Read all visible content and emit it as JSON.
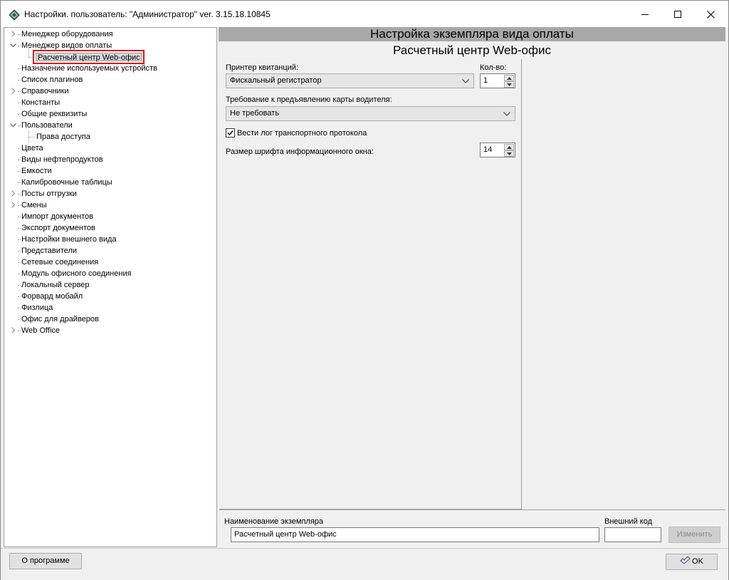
{
  "window": {
    "title": "Настройки. пользователь: \"Администратор\" ver. 3.15.18.10845"
  },
  "tree": {
    "items": [
      {
        "label": "Менеджер оборудования",
        "expander": "collapsed",
        "level": 0
      },
      {
        "label": "Менеджер видов оплаты",
        "expander": "expanded",
        "level": 0
      },
      {
        "label": "Расчетный центр Web-офис",
        "expander": "none",
        "level": 1,
        "selected": true
      },
      {
        "label": "Назначение используемых устройств",
        "expander": "none",
        "level": 0
      },
      {
        "label": "Список плагинов",
        "expander": "none",
        "level": 0
      },
      {
        "label": "Справочники",
        "expander": "collapsed",
        "level": 0
      },
      {
        "label": "Константы",
        "expander": "none",
        "level": 0
      },
      {
        "label": "Общие реквизиты",
        "expander": "none",
        "level": 0
      },
      {
        "label": "Пользователи",
        "expander": "expanded",
        "level": 0
      },
      {
        "label": "Права доступа",
        "expander": "none",
        "level": 1
      },
      {
        "label": "Цвета",
        "expander": "none",
        "level": 0
      },
      {
        "label": "Виды нефтепродуктов",
        "expander": "none",
        "level": 0
      },
      {
        "label": "Емкости",
        "expander": "none",
        "level": 0
      },
      {
        "label": "Калибровочные таблицы",
        "expander": "none",
        "level": 0
      },
      {
        "label": "Посты отгрузки",
        "expander": "collapsed",
        "level": 0
      },
      {
        "label": "Смены",
        "expander": "collapsed",
        "level": 0
      },
      {
        "label": "Импорт документов",
        "expander": "none",
        "level": 0
      },
      {
        "label": "Экспорт документов",
        "expander": "none",
        "level": 0
      },
      {
        "label": "Настройки внешнего вида",
        "expander": "none",
        "level": 0
      },
      {
        "label": "Представители",
        "expander": "none",
        "level": 0
      },
      {
        "label": "Сетевые соединения",
        "expander": "none",
        "level": 0
      },
      {
        "label": "Модуль офисного соединения",
        "expander": "none",
        "level": 0
      },
      {
        "label": "Локальный сервер",
        "expander": "none",
        "level": 0
      },
      {
        "label": "Форвард мобайл",
        "expander": "none",
        "level": 0
      },
      {
        "label": "Физлица",
        "expander": "none",
        "level": 0
      },
      {
        "label": "Офис для драйверов",
        "expander": "none",
        "level": 0
      },
      {
        "label": "Web Office",
        "expander": "collapsed",
        "level": 0
      }
    ]
  },
  "panel": {
    "header": "Настройка экземпляра вида оплаты",
    "subheader": "Расчетный центр Web-офис"
  },
  "settings": {
    "printer_label": "Принтер квитанций:",
    "printer_value": "Фискальный регистратор",
    "qty_label": "Кол-во:",
    "qty_value": "1",
    "driver_card_label": "Требование к предъявлению карты водителя:",
    "driver_card_value": "Не требовать",
    "log_label": "Вести лог транспортного протокола",
    "log_checked": true,
    "font_size_label": "Размер шрифта информационного окна:",
    "font_size_value": "14"
  },
  "instance": {
    "name_label": "Наименование экземпляра",
    "name_value": "Расчетный центр Web-офис",
    "ext_code_label": "Внешний код",
    "ext_code_value": "",
    "change_button": "Изменить"
  },
  "footer": {
    "about_button": "О программе",
    "ok_button": "OK"
  }
}
